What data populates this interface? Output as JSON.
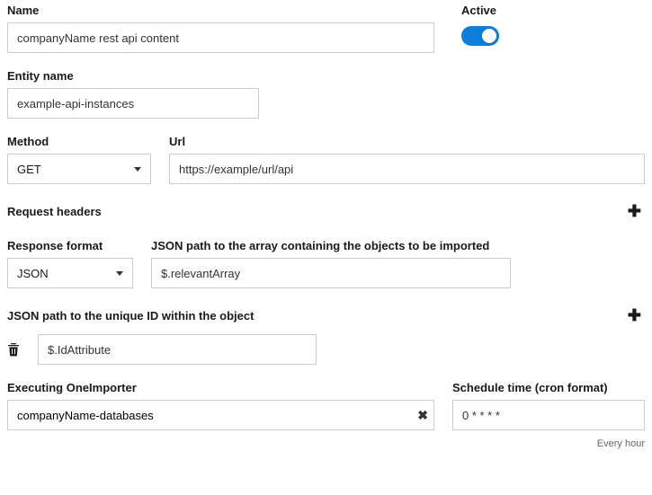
{
  "name": {
    "label": "Name",
    "value": "companyName rest api content"
  },
  "active": {
    "label": "Active",
    "checked": true
  },
  "entityName": {
    "label": "Entity name",
    "value": "example-api-instances"
  },
  "method": {
    "label": "Method",
    "value": "GET"
  },
  "url": {
    "label": "Url",
    "value": "https://example/url/api"
  },
  "requestHeaders": {
    "label": "Request headers"
  },
  "responseFormat": {
    "label": "Response format",
    "value": "JSON"
  },
  "jsonPathArray": {
    "label": "JSON path to the array containing the objects to be imported",
    "value": "$.relevantArray"
  },
  "jsonPathId": {
    "label": "JSON path to the unique ID within the object",
    "value": "$.IdAttribute"
  },
  "executingImporter": {
    "label": "Executing OneImporter",
    "value": "companyName-databases"
  },
  "schedule": {
    "label": "Schedule time (cron format)",
    "value": "0 * * * *",
    "helper": "Every hour"
  }
}
